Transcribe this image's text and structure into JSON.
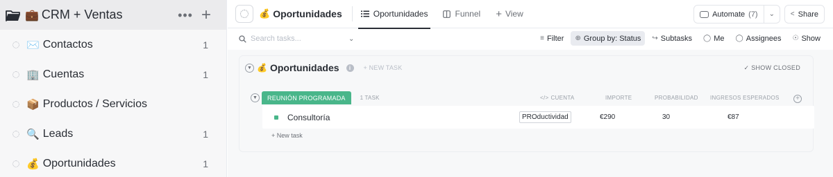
{
  "sidebar": {
    "title": "CRM + Ventas",
    "title_emoji": "💼",
    "more_label": "•••",
    "add_label": "+",
    "items": [
      {
        "emoji": "✉️",
        "label": "Contactos",
        "count": "1"
      },
      {
        "emoji": "🏢",
        "label": "Cuentas",
        "count": "1"
      },
      {
        "emoji": "📦",
        "label": "Productos / Servicios",
        "count": ""
      },
      {
        "emoji": "🔍",
        "label": "Leads",
        "count": "1"
      },
      {
        "emoji": "💰",
        "label": "Oportunidades",
        "count": "1"
      }
    ]
  },
  "topbar": {
    "list_emoji": "💰",
    "list_title": "Oportunidades",
    "tabs": [
      {
        "label": "Oportunidades",
        "icon": "list-icon",
        "active": true
      },
      {
        "label": "Funnel",
        "icon": "board-icon",
        "active": false
      }
    ],
    "add_view": "View",
    "automate_label": "Automate",
    "automate_count": "(7)",
    "share_label": "Share"
  },
  "toolbar": {
    "search_placeholder": "Search tasks...",
    "filter": "Filter",
    "group_by": "Group by: Status",
    "subtasks": "Subtasks",
    "me": "Me",
    "assignees": "Assignees",
    "show": "Show"
  },
  "list": {
    "emoji": "💰",
    "title": "Oportunidades",
    "new_task_top": "+ NEW TASK",
    "show_closed": "✓ SHOW CLOSED",
    "group": {
      "status": "REUNIÓN PROGRAMADA",
      "status_color": "#49b68a",
      "task_count": "1 TASK"
    },
    "columns": [
      "CUENTA",
      "IMPORTE",
      "PROBABILIDAD",
      "INGRESOS ESPERADOS"
    ],
    "tasks": [
      {
        "name": "Consultoría",
        "cuenta": "PROductividad",
        "importe": "€290",
        "probabilidad": "30",
        "ingresos": "€87"
      }
    ],
    "new_task_bottom": "+ New task"
  }
}
